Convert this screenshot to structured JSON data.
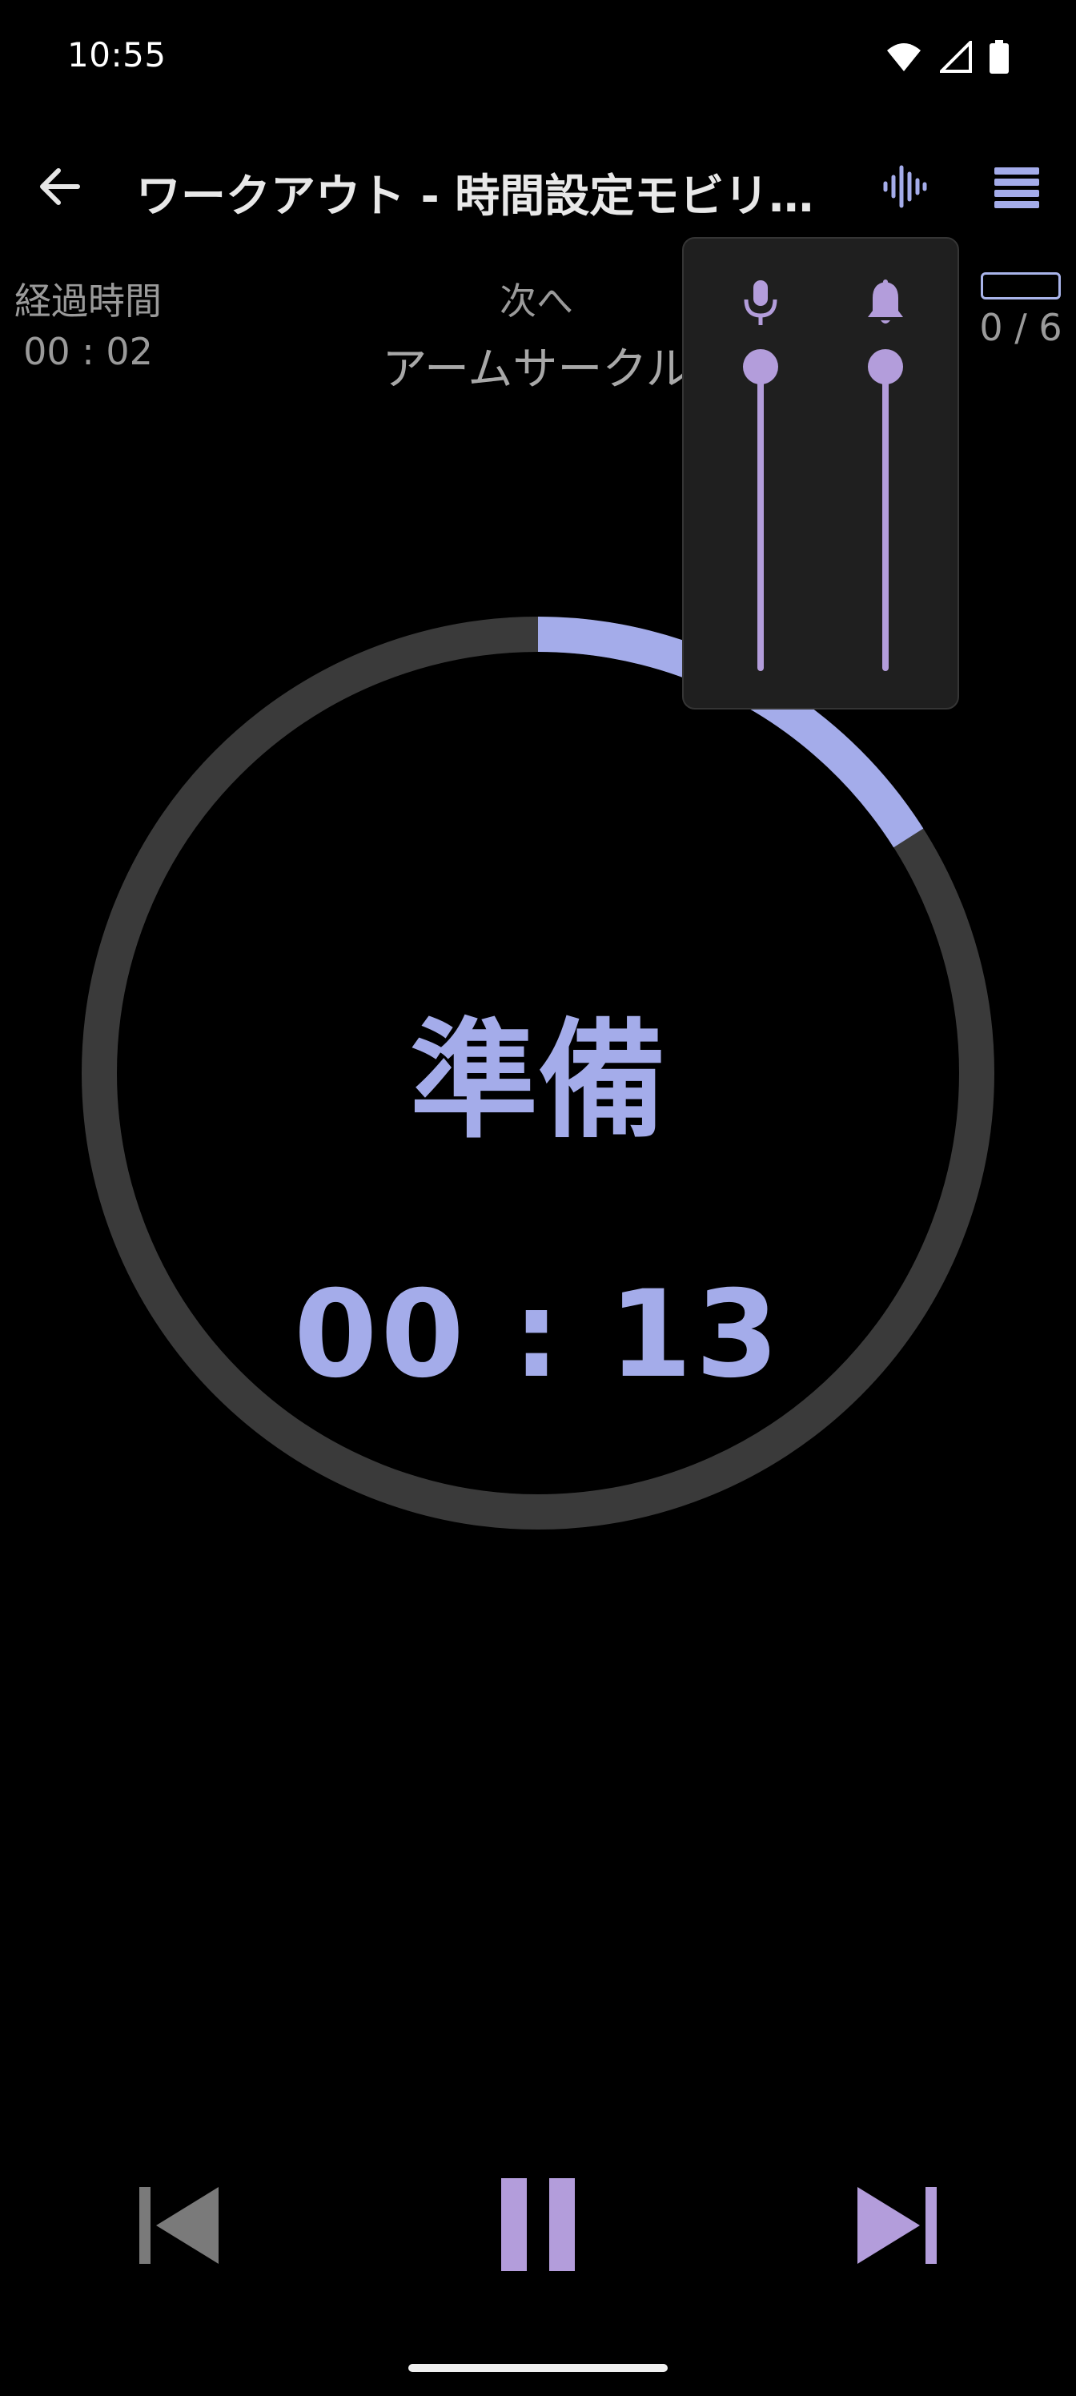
{
  "status_bar": {
    "time": "10:55",
    "icons": [
      "wifi-icon",
      "cell-signal-icon",
      "battery-icon"
    ]
  },
  "app_bar": {
    "title": "ワークアウト - 時間設定モビリテ…",
    "back_icon": "arrow-back-icon",
    "sound_icon": "sound-wave-icon",
    "menu_icon": "list-menu-icon"
  },
  "info": {
    "elapsed_label": "経過時間",
    "elapsed_value": "00 : 02",
    "next_label": "次へ",
    "next_value": "アームサークル",
    "progress_text": "0 / 6"
  },
  "timer": {
    "phase": "準備",
    "countdown": "00 : 13",
    "ring_progress": 0.16
  },
  "volume_popup": {
    "voice_icon": "microphone-icon",
    "beep_icon": "bell-icon",
    "voice_level": 1.0,
    "beep_level": 1.0
  },
  "controls": {
    "prev_icon": "skip-previous-icon",
    "pause_icon": "pause-icon",
    "next_icon": "skip-next-icon"
  },
  "colors": {
    "accent": "#a4acea",
    "slider": "#b39ddb",
    "ring_track": "#3a3a3a",
    "background": "#000000",
    "control_gray": "#7a7a7a"
  }
}
